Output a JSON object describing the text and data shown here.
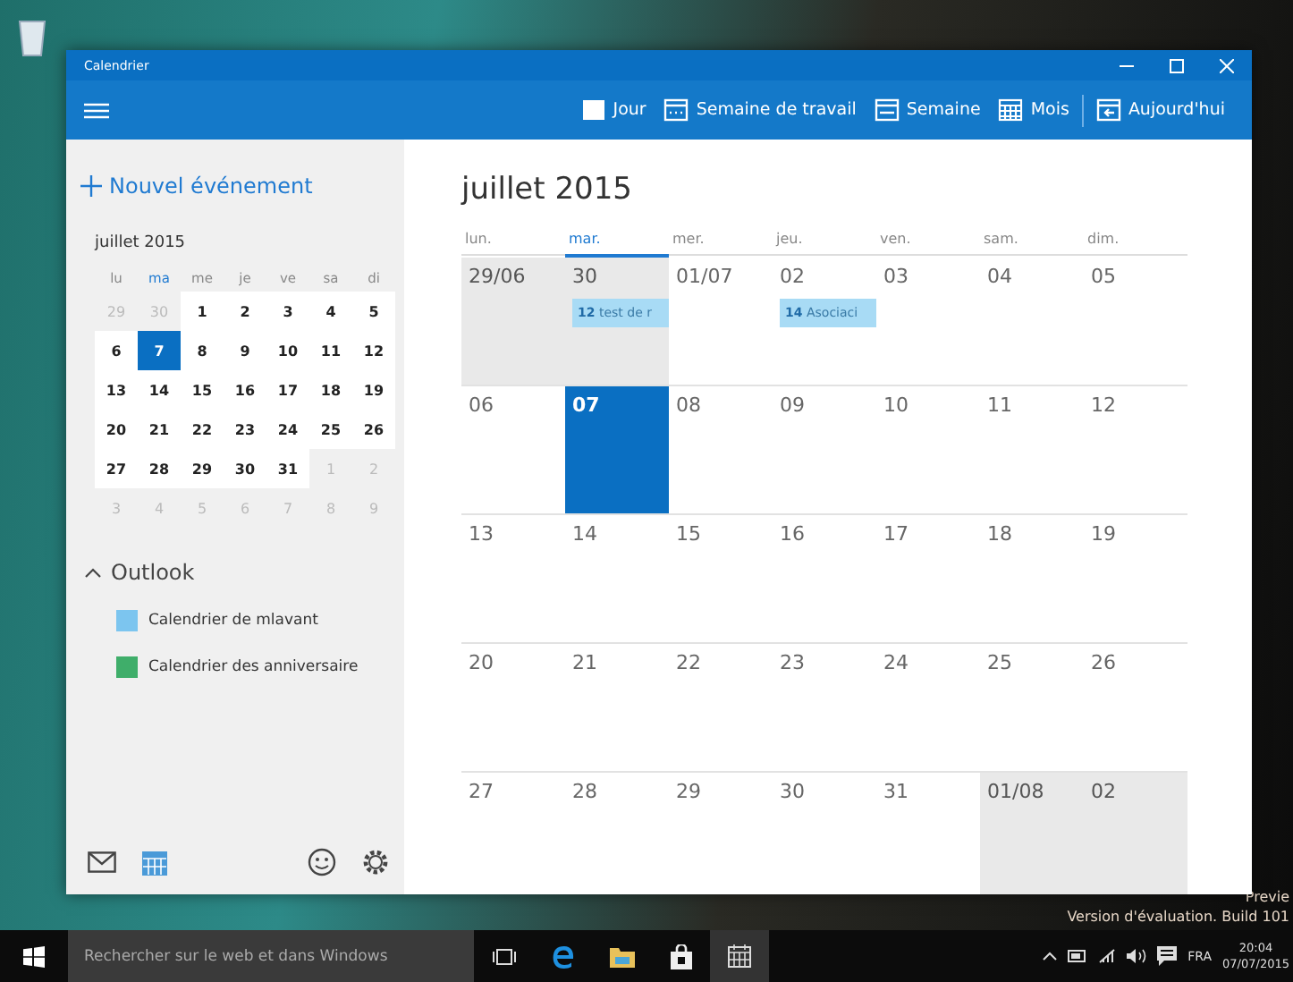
{
  "desktop": {
    "watermark_lines": [
      "Previe",
      "Version d'évaluation. Build 101"
    ]
  },
  "window": {
    "title": "Calendrier"
  },
  "toolbar": {
    "views": [
      {
        "label": "Jour",
        "kind": "day"
      },
      {
        "label": "Semaine de travail",
        "kind": "workweek"
      },
      {
        "label": "Semaine",
        "kind": "week"
      },
      {
        "label": "Mois",
        "kind": "month"
      },
      {
        "label": "Aujourd'hui",
        "kind": "today"
      }
    ]
  },
  "sidebar": {
    "new_event": "Nouvel événement",
    "mini_calendar": {
      "title": "juillet 2015",
      "weekdays": [
        {
          "label": "lu",
          "selected": false
        },
        {
          "label": "ma",
          "selected": true
        },
        {
          "label": "me",
          "selected": false
        },
        {
          "label": "je",
          "selected": false
        },
        {
          "label": "ve",
          "selected": false
        },
        {
          "label": "sa",
          "selected": false
        },
        {
          "label": "di",
          "selected": false
        }
      ],
      "weeks": [
        [
          {
            "label": "29",
            "outside": true,
            "selected": false
          },
          {
            "label": "30",
            "outside": true,
            "selected": false
          },
          {
            "label": "1",
            "outside": false,
            "selected": false
          },
          {
            "label": "2",
            "outside": false,
            "selected": false
          },
          {
            "label": "3",
            "outside": false,
            "selected": false
          },
          {
            "label": "4",
            "outside": false,
            "selected": false
          },
          {
            "label": "5",
            "outside": false,
            "selected": false
          }
        ],
        [
          {
            "label": "6",
            "outside": false,
            "selected": false
          },
          {
            "label": "7",
            "outside": false,
            "selected": true
          },
          {
            "label": "8",
            "outside": false,
            "selected": false
          },
          {
            "label": "9",
            "outside": false,
            "selected": false
          },
          {
            "label": "10",
            "outside": false,
            "selected": false
          },
          {
            "label": "11",
            "outside": false,
            "selected": false
          },
          {
            "label": "12",
            "outside": false,
            "selected": false
          }
        ],
        [
          {
            "label": "13",
            "outside": false,
            "selected": false
          },
          {
            "label": "14",
            "outside": false,
            "selected": false
          },
          {
            "label": "15",
            "outside": false,
            "selected": false
          },
          {
            "label": "16",
            "outside": false,
            "selected": false
          },
          {
            "label": "17",
            "outside": false,
            "selected": false
          },
          {
            "label": "18",
            "outside": false,
            "selected": false
          },
          {
            "label": "19",
            "outside": false,
            "selected": false
          }
        ],
        [
          {
            "label": "20",
            "outside": false,
            "selected": false
          },
          {
            "label": "21",
            "outside": false,
            "selected": false
          },
          {
            "label": "22",
            "outside": false,
            "selected": false
          },
          {
            "label": "23",
            "outside": false,
            "selected": false
          },
          {
            "label": "24",
            "outside": false,
            "selected": false
          },
          {
            "label": "25",
            "outside": false,
            "selected": false
          },
          {
            "label": "26",
            "outside": false,
            "selected": false
          }
        ],
        [
          {
            "label": "27",
            "outside": false,
            "selected": false
          },
          {
            "label": "28",
            "outside": false,
            "selected": false
          },
          {
            "label": "29",
            "outside": false,
            "selected": false
          },
          {
            "label": "30",
            "outside": false,
            "selected": false
          },
          {
            "label": "31",
            "outside": false,
            "selected": false
          },
          {
            "label": "1",
            "outside": true,
            "selected": false
          },
          {
            "label": "2",
            "outside": true,
            "selected": false
          }
        ],
        [
          {
            "label": "3",
            "outside": true,
            "selected": false
          },
          {
            "label": "4",
            "outside": true,
            "selected": false
          },
          {
            "label": "5",
            "outside": true,
            "selected": false
          },
          {
            "label": "6",
            "outside": true,
            "selected": false
          },
          {
            "label": "7",
            "outside": true,
            "selected": false
          },
          {
            "label": "8",
            "outside": true,
            "selected": false
          },
          {
            "label": "9",
            "outside": true,
            "selected": false
          }
        ]
      ]
    },
    "account": {
      "name": "Outlook",
      "expanded": true,
      "calendars": [
        {
          "name": "Calendrier de mlavant",
          "color": "#7cc5ef"
        },
        {
          "name": "Calendrier des anniversaire",
          "color": "#3fae6a"
        }
      ]
    }
  },
  "month_view": {
    "title": "juillet 2015",
    "weekdays": [
      {
        "label": "lun.",
        "selected": false
      },
      {
        "label": "mar.",
        "selected": true
      },
      {
        "label": "mer.",
        "selected": false
      },
      {
        "label": "jeu.",
        "selected": false
      },
      {
        "label": "ven.",
        "selected": false
      },
      {
        "label": "sam.",
        "selected": false
      },
      {
        "label": "dim.",
        "selected": false
      }
    ],
    "weeks": [
      [
        {
          "label": "29/06",
          "outside": true,
          "today": false
        },
        {
          "label": "30",
          "outside": true,
          "today": false,
          "events": [
            {
              "time": "12",
              "title": "test de r"
            }
          ]
        },
        {
          "label": "01/07",
          "outside": false,
          "today": false
        },
        {
          "label": "02",
          "outside": false,
          "today": false,
          "events": [
            {
              "time": "14",
              "title": "Asociaci"
            }
          ]
        },
        {
          "label": "03",
          "outside": false,
          "today": false
        },
        {
          "label": "04",
          "outside": false,
          "today": false
        },
        {
          "label": "05",
          "outside": false,
          "today": false
        }
      ],
      [
        {
          "label": "06",
          "outside": false,
          "today": false
        },
        {
          "label": "07",
          "outside": false,
          "today": true
        },
        {
          "label": "08",
          "outside": false,
          "today": false
        },
        {
          "label": "09",
          "outside": false,
          "today": false
        },
        {
          "label": "10",
          "outside": false,
          "today": false
        },
        {
          "label": "11",
          "outside": false,
          "today": false
        },
        {
          "label": "12",
          "outside": false,
          "today": false
        }
      ],
      [
        {
          "label": "13",
          "outside": false,
          "today": false
        },
        {
          "label": "14",
          "outside": false,
          "today": false
        },
        {
          "label": "15",
          "outside": false,
          "today": false
        },
        {
          "label": "16",
          "outside": false,
          "today": false
        },
        {
          "label": "17",
          "outside": false,
          "today": false
        },
        {
          "label": "18",
          "outside": false,
          "today": false
        },
        {
          "label": "19",
          "outside": false,
          "today": false
        }
      ],
      [
        {
          "label": "20",
          "outside": false,
          "today": false
        },
        {
          "label": "21",
          "outside": false,
          "today": false
        },
        {
          "label": "22",
          "outside": false,
          "today": false
        },
        {
          "label": "23",
          "outside": false,
          "today": false
        },
        {
          "label": "24",
          "outside": false,
          "today": false
        },
        {
          "label": "25",
          "outside": false,
          "today": false
        },
        {
          "label": "26",
          "outside": false,
          "today": false
        }
      ],
      [
        {
          "label": "27",
          "outside": false,
          "today": false
        },
        {
          "label": "28",
          "outside": false,
          "today": false
        },
        {
          "label": "29",
          "outside": false,
          "today": false
        },
        {
          "label": "30",
          "outside": false,
          "today": false
        },
        {
          "label": "31",
          "outside": false,
          "today": false
        },
        {
          "label": "01/08",
          "outside": true,
          "today": false
        },
        {
          "label": "02",
          "outside": true,
          "today": false
        }
      ]
    ]
  },
  "taskbar": {
    "search_placeholder": "Rechercher sur le web et dans Windows",
    "language": "FRA",
    "time": "20:04",
    "date": "07/07/2015"
  }
}
